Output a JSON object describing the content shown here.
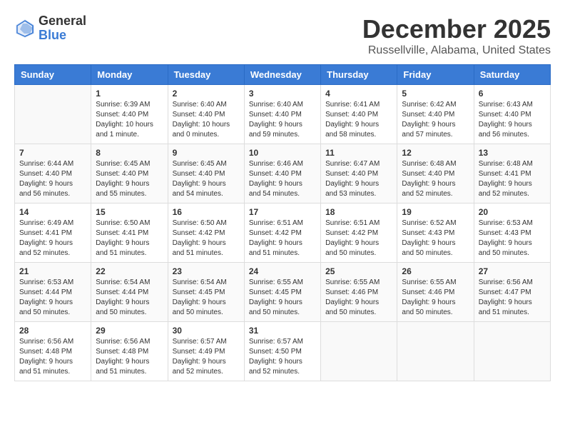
{
  "logo": {
    "general": "General",
    "blue": "Blue"
  },
  "title": "December 2025",
  "subtitle": "Russellville, Alabama, United States",
  "weekdays": [
    "Sunday",
    "Monday",
    "Tuesday",
    "Wednesday",
    "Thursday",
    "Friday",
    "Saturday"
  ],
  "weeks": [
    [
      {
        "day": "",
        "info": ""
      },
      {
        "day": "1",
        "info": "Sunrise: 6:39 AM\nSunset: 4:40 PM\nDaylight: 10 hours\nand 1 minute."
      },
      {
        "day": "2",
        "info": "Sunrise: 6:40 AM\nSunset: 4:40 PM\nDaylight: 10 hours\nand 0 minutes."
      },
      {
        "day": "3",
        "info": "Sunrise: 6:40 AM\nSunset: 4:40 PM\nDaylight: 9 hours\nand 59 minutes."
      },
      {
        "day": "4",
        "info": "Sunrise: 6:41 AM\nSunset: 4:40 PM\nDaylight: 9 hours\nand 58 minutes."
      },
      {
        "day": "5",
        "info": "Sunrise: 6:42 AM\nSunset: 4:40 PM\nDaylight: 9 hours\nand 57 minutes."
      },
      {
        "day": "6",
        "info": "Sunrise: 6:43 AM\nSunset: 4:40 PM\nDaylight: 9 hours\nand 56 minutes."
      }
    ],
    [
      {
        "day": "7",
        "info": "Sunrise: 6:44 AM\nSunset: 4:40 PM\nDaylight: 9 hours\nand 56 minutes."
      },
      {
        "day": "8",
        "info": "Sunrise: 6:45 AM\nSunset: 4:40 PM\nDaylight: 9 hours\nand 55 minutes."
      },
      {
        "day": "9",
        "info": "Sunrise: 6:45 AM\nSunset: 4:40 PM\nDaylight: 9 hours\nand 54 minutes."
      },
      {
        "day": "10",
        "info": "Sunrise: 6:46 AM\nSunset: 4:40 PM\nDaylight: 9 hours\nand 54 minutes."
      },
      {
        "day": "11",
        "info": "Sunrise: 6:47 AM\nSunset: 4:40 PM\nDaylight: 9 hours\nand 53 minutes."
      },
      {
        "day": "12",
        "info": "Sunrise: 6:48 AM\nSunset: 4:40 PM\nDaylight: 9 hours\nand 52 minutes."
      },
      {
        "day": "13",
        "info": "Sunrise: 6:48 AM\nSunset: 4:41 PM\nDaylight: 9 hours\nand 52 minutes."
      }
    ],
    [
      {
        "day": "14",
        "info": "Sunrise: 6:49 AM\nSunset: 4:41 PM\nDaylight: 9 hours\nand 52 minutes."
      },
      {
        "day": "15",
        "info": "Sunrise: 6:50 AM\nSunset: 4:41 PM\nDaylight: 9 hours\nand 51 minutes."
      },
      {
        "day": "16",
        "info": "Sunrise: 6:50 AM\nSunset: 4:42 PM\nDaylight: 9 hours\nand 51 minutes."
      },
      {
        "day": "17",
        "info": "Sunrise: 6:51 AM\nSunset: 4:42 PM\nDaylight: 9 hours\nand 51 minutes."
      },
      {
        "day": "18",
        "info": "Sunrise: 6:51 AM\nSunset: 4:42 PM\nDaylight: 9 hours\nand 50 minutes."
      },
      {
        "day": "19",
        "info": "Sunrise: 6:52 AM\nSunset: 4:43 PM\nDaylight: 9 hours\nand 50 minutes."
      },
      {
        "day": "20",
        "info": "Sunrise: 6:53 AM\nSunset: 4:43 PM\nDaylight: 9 hours\nand 50 minutes."
      }
    ],
    [
      {
        "day": "21",
        "info": "Sunrise: 6:53 AM\nSunset: 4:44 PM\nDaylight: 9 hours\nand 50 minutes."
      },
      {
        "day": "22",
        "info": "Sunrise: 6:54 AM\nSunset: 4:44 PM\nDaylight: 9 hours\nand 50 minutes."
      },
      {
        "day": "23",
        "info": "Sunrise: 6:54 AM\nSunset: 4:45 PM\nDaylight: 9 hours\nand 50 minutes."
      },
      {
        "day": "24",
        "info": "Sunrise: 6:55 AM\nSunset: 4:45 PM\nDaylight: 9 hours\nand 50 minutes."
      },
      {
        "day": "25",
        "info": "Sunrise: 6:55 AM\nSunset: 4:46 PM\nDaylight: 9 hours\nand 50 minutes."
      },
      {
        "day": "26",
        "info": "Sunrise: 6:55 AM\nSunset: 4:46 PM\nDaylight: 9 hours\nand 50 minutes."
      },
      {
        "day": "27",
        "info": "Sunrise: 6:56 AM\nSunset: 4:47 PM\nDaylight: 9 hours\nand 51 minutes."
      }
    ],
    [
      {
        "day": "28",
        "info": "Sunrise: 6:56 AM\nSunset: 4:48 PM\nDaylight: 9 hours\nand 51 minutes."
      },
      {
        "day": "29",
        "info": "Sunrise: 6:56 AM\nSunset: 4:48 PM\nDaylight: 9 hours\nand 51 minutes."
      },
      {
        "day": "30",
        "info": "Sunrise: 6:57 AM\nSunset: 4:49 PM\nDaylight: 9 hours\nand 52 minutes."
      },
      {
        "day": "31",
        "info": "Sunrise: 6:57 AM\nSunset: 4:50 PM\nDaylight: 9 hours\nand 52 minutes."
      },
      {
        "day": "",
        "info": ""
      },
      {
        "day": "",
        "info": ""
      },
      {
        "day": "",
        "info": ""
      }
    ]
  ]
}
